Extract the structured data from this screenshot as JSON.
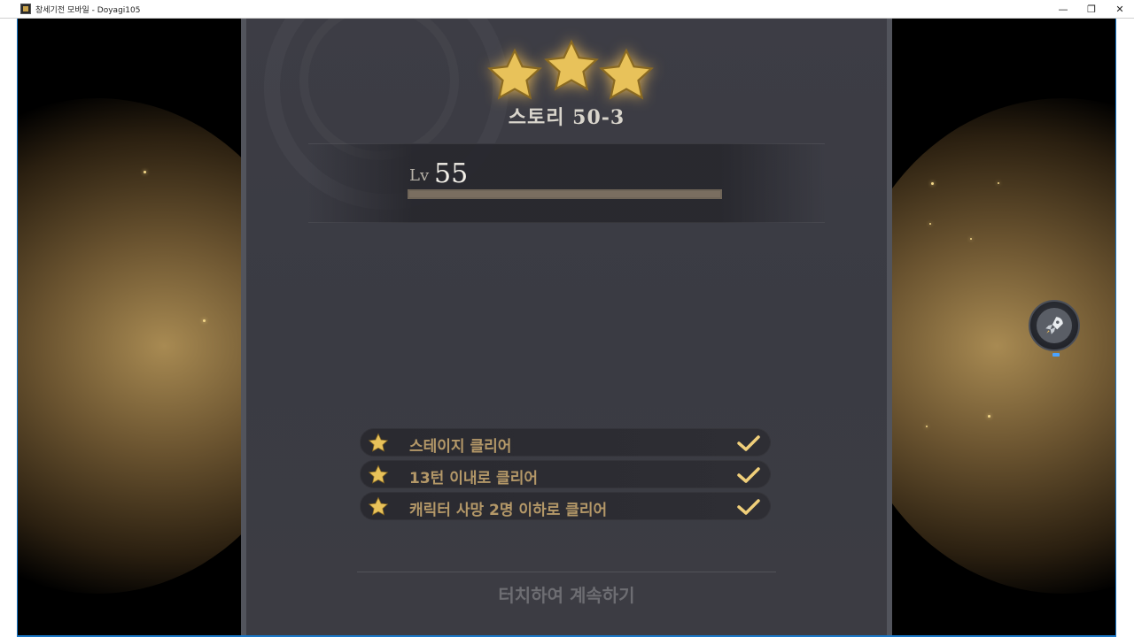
{
  "window": {
    "title": "창세기전 모바일 - Doyagi105",
    "minimize": "—",
    "restore": "❐",
    "close": "✕"
  },
  "result": {
    "stars_earned": 3,
    "stage_title": "스토리 50-3",
    "level_label": "Lv",
    "level_value": "55",
    "level_progress": 1.0
  },
  "missions": [
    {
      "label": "스테이지 클리어",
      "completed": true
    },
    {
      "label": "13턴 이내로 클리어",
      "completed": true
    },
    {
      "label": "캐릭터 사망 2명 이하로 클리어",
      "completed": true
    }
  ],
  "continue_text": "터치하여 계속하기",
  "colors": {
    "star_gold": "#e8c25a",
    "mission_text": "#b49868",
    "check_gold": "#f0cf7a"
  },
  "icons": {
    "app": "app-icon",
    "star": "star-icon",
    "check": "checkmark-icon",
    "rocket": "rocket-icon"
  }
}
